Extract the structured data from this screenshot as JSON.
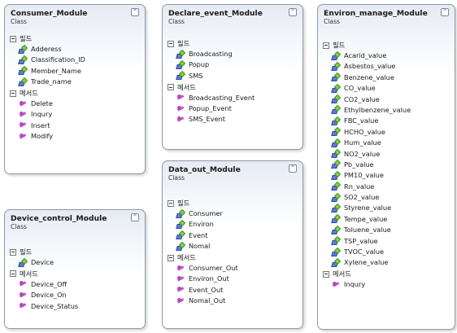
{
  "labels": {
    "class": "Class",
    "fields": "필드",
    "methods": "메서드",
    "collapse": "^"
  },
  "consumer": {
    "title": "Consumer_Module",
    "fields": [
      "Adderess",
      "Classification_ID",
      "Member_Name",
      "Trade_name"
    ],
    "methods": [
      "Delete",
      "Inqury",
      "Insert",
      "Modify"
    ]
  },
  "declare": {
    "title": "Declare_event_Module",
    "fields": [
      "Broadcasting",
      "Popup",
      "SMS"
    ],
    "methods": [
      "Broadcasting_Event",
      "Popup_Event",
      "SMS_Event"
    ]
  },
  "environ": {
    "title": "Environ_manage_Module",
    "fields": [
      "Acarid_value",
      "Asbestos_value",
      "Benzene_value",
      "CO_value",
      "CO2_value",
      "Ethylbenzene_value",
      "FBC_value",
      "HCHO_value",
      "Hum_value",
      "NO2_value",
      "Pb_value",
      "PM10_value",
      "Rn_value",
      "SO2_value",
      "Styrene_value",
      "Tempe_value",
      "Toluene_value",
      "TSP_value",
      "TVOC_value",
      "Xylene_value"
    ],
    "methods": [
      "Inqury"
    ]
  },
  "device": {
    "title": "Device_control_Module",
    "fields": [
      "Device"
    ],
    "methods": [
      "Device_Off",
      "Device_On",
      "Device_Status"
    ]
  },
  "dataout": {
    "title": "Data_out_Module",
    "fields": [
      "Consumer",
      "Environ",
      "Event",
      "Nomal"
    ],
    "methods": [
      "Consumer_Out",
      "Environ_Out",
      "Event_Out",
      "Nomal_Out"
    ]
  }
}
